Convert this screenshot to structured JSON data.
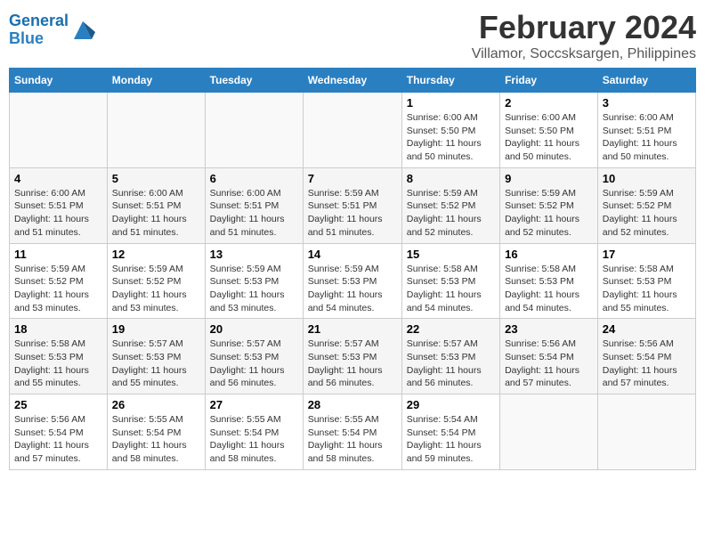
{
  "logo": {
    "line1": "General",
    "line2": "Blue"
  },
  "title": "February 2024",
  "subtitle": "Villamor, Soccsksargen, Philippines",
  "days_of_week": [
    "Sunday",
    "Monday",
    "Tuesday",
    "Wednesday",
    "Thursday",
    "Friday",
    "Saturday"
  ],
  "weeks": [
    [
      {
        "day": "",
        "info": ""
      },
      {
        "day": "",
        "info": ""
      },
      {
        "day": "",
        "info": ""
      },
      {
        "day": "",
        "info": ""
      },
      {
        "day": "1",
        "info": "Sunrise: 6:00 AM\nSunset: 5:50 PM\nDaylight: 11 hours\nand 50 minutes."
      },
      {
        "day": "2",
        "info": "Sunrise: 6:00 AM\nSunset: 5:50 PM\nDaylight: 11 hours\nand 50 minutes."
      },
      {
        "day": "3",
        "info": "Sunrise: 6:00 AM\nSunset: 5:51 PM\nDaylight: 11 hours\nand 50 minutes."
      }
    ],
    [
      {
        "day": "4",
        "info": "Sunrise: 6:00 AM\nSunset: 5:51 PM\nDaylight: 11 hours\nand 51 minutes."
      },
      {
        "day": "5",
        "info": "Sunrise: 6:00 AM\nSunset: 5:51 PM\nDaylight: 11 hours\nand 51 minutes."
      },
      {
        "day": "6",
        "info": "Sunrise: 6:00 AM\nSunset: 5:51 PM\nDaylight: 11 hours\nand 51 minutes."
      },
      {
        "day": "7",
        "info": "Sunrise: 5:59 AM\nSunset: 5:51 PM\nDaylight: 11 hours\nand 51 minutes."
      },
      {
        "day": "8",
        "info": "Sunrise: 5:59 AM\nSunset: 5:52 PM\nDaylight: 11 hours\nand 52 minutes."
      },
      {
        "day": "9",
        "info": "Sunrise: 5:59 AM\nSunset: 5:52 PM\nDaylight: 11 hours\nand 52 minutes."
      },
      {
        "day": "10",
        "info": "Sunrise: 5:59 AM\nSunset: 5:52 PM\nDaylight: 11 hours\nand 52 minutes."
      }
    ],
    [
      {
        "day": "11",
        "info": "Sunrise: 5:59 AM\nSunset: 5:52 PM\nDaylight: 11 hours\nand 53 minutes."
      },
      {
        "day": "12",
        "info": "Sunrise: 5:59 AM\nSunset: 5:52 PM\nDaylight: 11 hours\nand 53 minutes."
      },
      {
        "day": "13",
        "info": "Sunrise: 5:59 AM\nSunset: 5:53 PM\nDaylight: 11 hours\nand 53 minutes."
      },
      {
        "day": "14",
        "info": "Sunrise: 5:59 AM\nSunset: 5:53 PM\nDaylight: 11 hours\nand 54 minutes."
      },
      {
        "day": "15",
        "info": "Sunrise: 5:58 AM\nSunset: 5:53 PM\nDaylight: 11 hours\nand 54 minutes."
      },
      {
        "day": "16",
        "info": "Sunrise: 5:58 AM\nSunset: 5:53 PM\nDaylight: 11 hours\nand 54 minutes."
      },
      {
        "day": "17",
        "info": "Sunrise: 5:58 AM\nSunset: 5:53 PM\nDaylight: 11 hours\nand 55 minutes."
      }
    ],
    [
      {
        "day": "18",
        "info": "Sunrise: 5:58 AM\nSunset: 5:53 PM\nDaylight: 11 hours\nand 55 minutes."
      },
      {
        "day": "19",
        "info": "Sunrise: 5:57 AM\nSunset: 5:53 PM\nDaylight: 11 hours\nand 55 minutes."
      },
      {
        "day": "20",
        "info": "Sunrise: 5:57 AM\nSunset: 5:53 PM\nDaylight: 11 hours\nand 56 minutes."
      },
      {
        "day": "21",
        "info": "Sunrise: 5:57 AM\nSunset: 5:53 PM\nDaylight: 11 hours\nand 56 minutes."
      },
      {
        "day": "22",
        "info": "Sunrise: 5:57 AM\nSunset: 5:53 PM\nDaylight: 11 hours\nand 56 minutes."
      },
      {
        "day": "23",
        "info": "Sunrise: 5:56 AM\nSunset: 5:54 PM\nDaylight: 11 hours\nand 57 minutes."
      },
      {
        "day": "24",
        "info": "Sunrise: 5:56 AM\nSunset: 5:54 PM\nDaylight: 11 hours\nand 57 minutes."
      }
    ],
    [
      {
        "day": "25",
        "info": "Sunrise: 5:56 AM\nSunset: 5:54 PM\nDaylight: 11 hours\nand 57 minutes."
      },
      {
        "day": "26",
        "info": "Sunrise: 5:55 AM\nSunset: 5:54 PM\nDaylight: 11 hours\nand 58 minutes."
      },
      {
        "day": "27",
        "info": "Sunrise: 5:55 AM\nSunset: 5:54 PM\nDaylight: 11 hours\nand 58 minutes."
      },
      {
        "day": "28",
        "info": "Sunrise: 5:55 AM\nSunset: 5:54 PM\nDaylight: 11 hours\nand 58 minutes."
      },
      {
        "day": "29",
        "info": "Sunrise: 5:54 AM\nSunset: 5:54 PM\nDaylight: 11 hours\nand 59 minutes."
      },
      {
        "day": "",
        "info": ""
      },
      {
        "day": "",
        "info": ""
      }
    ]
  ]
}
